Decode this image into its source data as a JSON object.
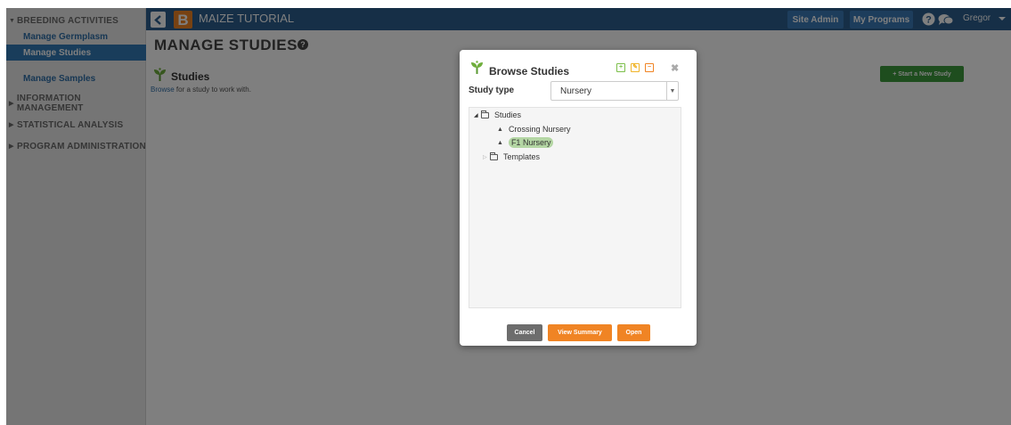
{
  "sidebar": {
    "sections": [
      {
        "label": "BREEDING ACTIVITIES",
        "expanded": true,
        "items": [
          {
            "label": "Manage Germplasm",
            "active": false
          },
          {
            "label": "Manage Studies",
            "active": true
          },
          {
            "label": "Manage Samples",
            "active": false
          }
        ]
      },
      {
        "label": "INFORMATION MANAGEMENT",
        "expanded": false
      },
      {
        "label": "STATISTICAL ANALYSIS",
        "expanded": false
      },
      {
        "label": "PROGRAM ADMINISTRATION",
        "expanded": false
      }
    ]
  },
  "header": {
    "logo_letter": "B",
    "app_title": "MAIZE TUTORIAL",
    "site_admin_label": "Site Admin",
    "my_programs_label": "My Programs",
    "user_name": "Gregor"
  },
  "main": {
    "page_title": "MANAGE STUDIES",
    "studies_heading": "Studies",
    "browse_link": "Browse",
    "browse_suffix": " for a study to work with.",
    "start_study_label": "+ Start a New Study"
  },
  "modal": {
    "title": "Browse Studies",
    "study_type_label": "Study type",
    "study_type_value": "Nursery",
    "tree": {
      "root": "Studies",
      "children": [
        {
          "label": "Crossing Nursery",
          "selected": false
        },
        {
          "label": "F1 Nursery",
          "selected": true
        }
      ],
      "templates": "Templates"
    },
    "buttons": {
      "cancel": "Cancel",
      "view_summary": "View Summary",
      "open": "Open"
    }
  },
  "colors": {
    "topbar": "#2c5e8e",
    "accent": "#f08424",
    "link": "#2f6fa8",
    "active_nav": "#337ab7",
    "start_button": "#3c9a3c",
    "cancel_button": "#6d6d6d",
    "selected_node": "#b4d6a4"
  }
}
